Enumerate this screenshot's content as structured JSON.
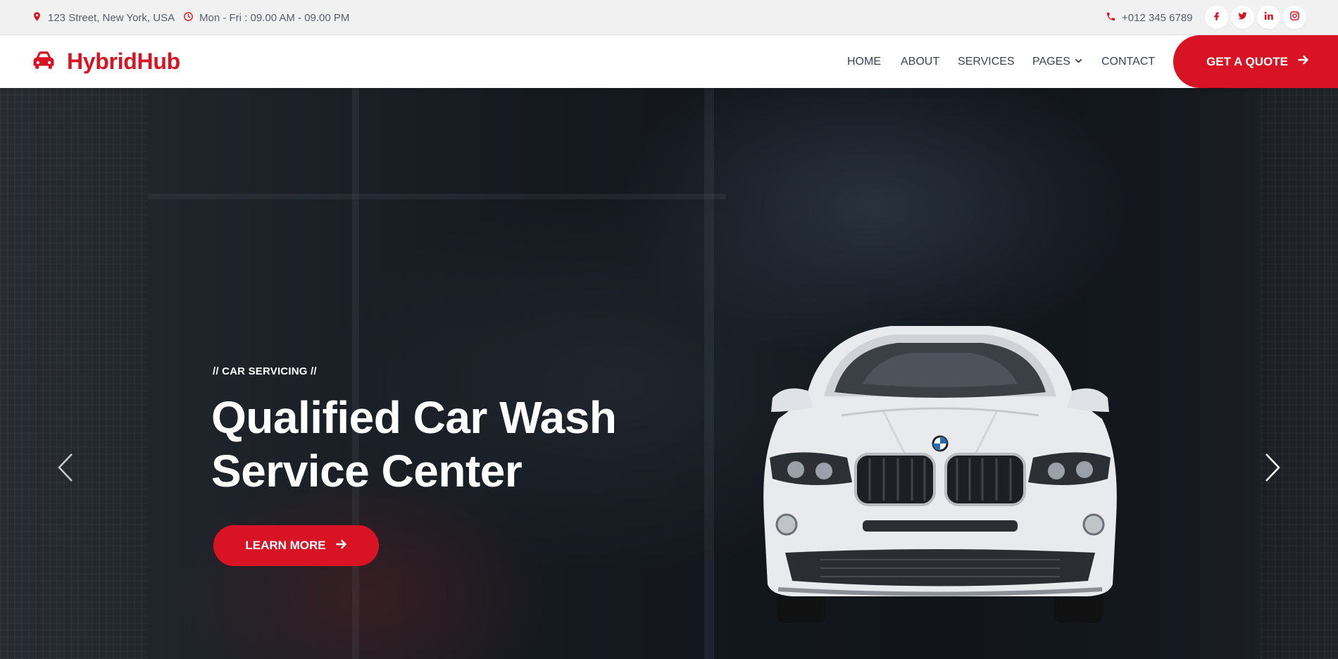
{
  "topbar": {
    "address": "123 Street, New York, USA",
    "hours": "Mon - Fri : 09.00 AM - 09.00 PM",
    "phone": "+012 345 6789",
    "socials": [
      "facebook-icon",
      "twitter-icon",
      "linkedin-icon",
      "instagram-icon"
    ]
  },
  "nav": {
    "brand": "HybridHub",
    "items": [
      "HOME",
      "ABOUT",
      "SERVICES",
      "PAGES",
      "CONTACT"
    ],
    "cta": "GET A QUOTE"
  },
  "hero": {
    "eyebrow": "// CAR SERVICING //",
    "headline_line1": "Qualified Car Wash",
    "headline_line2": "Service Center",
    "button": "LEARN MORE"
  },
  "colors": {
    "accent": "#d81324",
    "topbar_bg": "#f1f1f2",
    "nav_text": "#3b4350"
  }
}
